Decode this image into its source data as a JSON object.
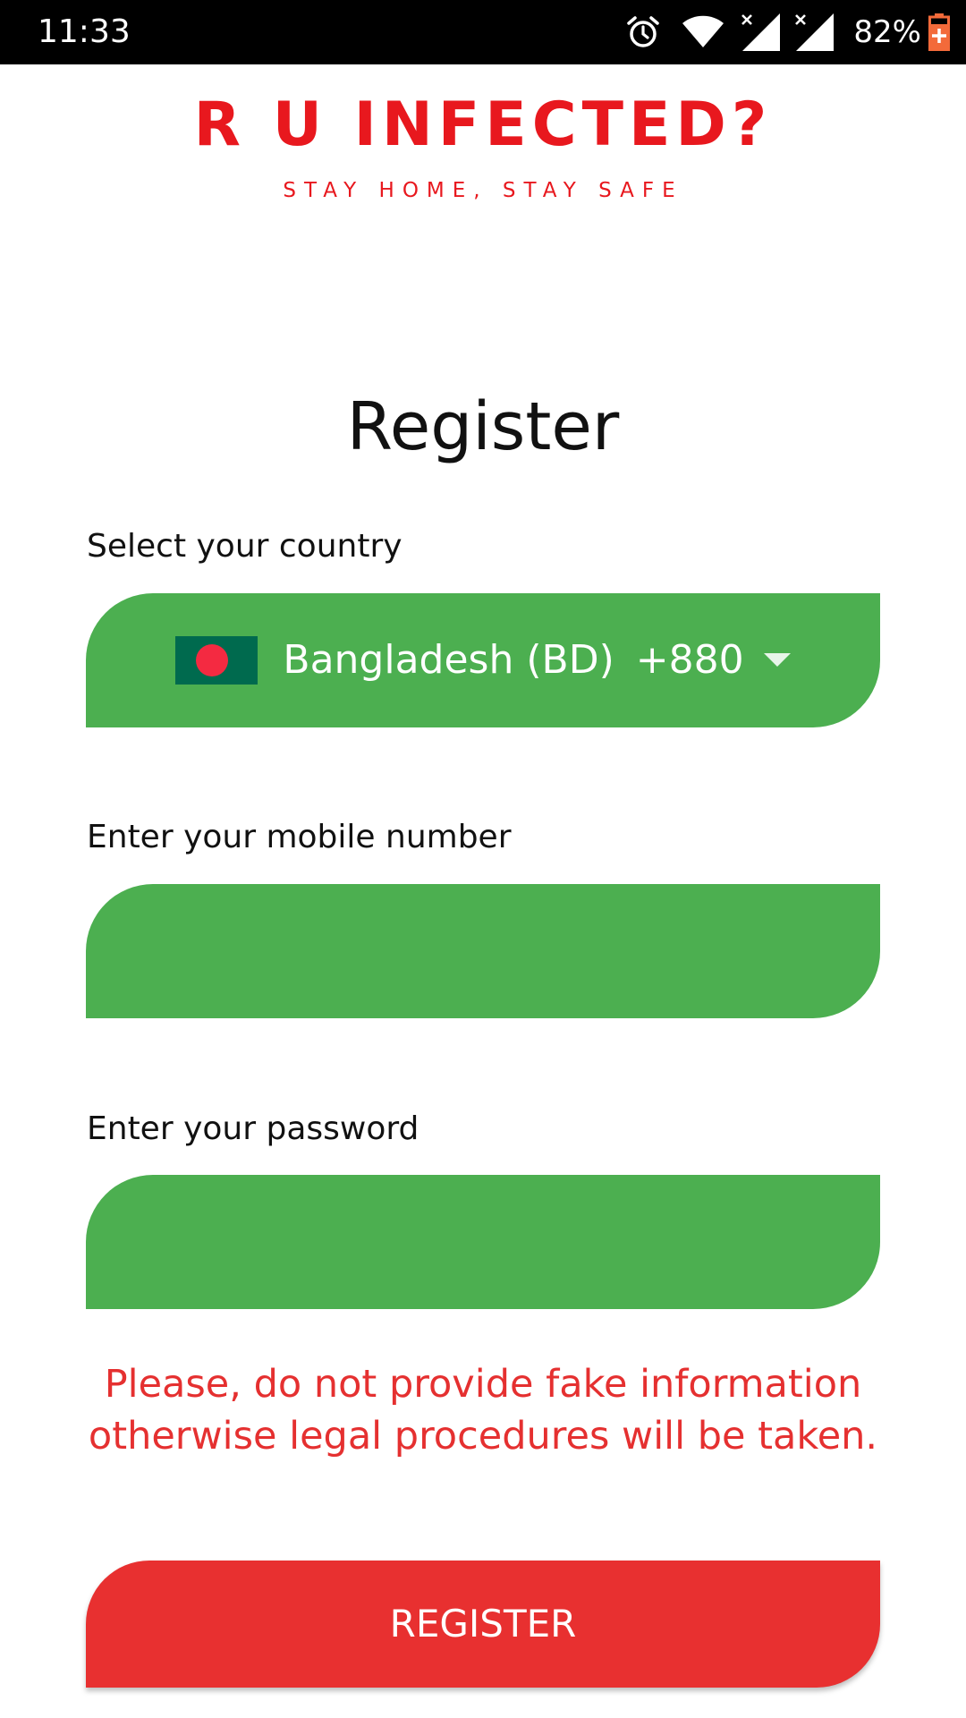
{
  "status_bar": {
    "time": "11:33",
    "battery_percent": "82%",
    "icons": [
      "alarm-icon",
      "wifi-icon",
      "signal-icon",
      "signal-icon",
      "battery-charging-icon"
    ]
  },
  "logo": {
    "title": "R U INFECTED?",
    "tagline": "STAY HOME, STAY SAFE"
  },
  "form": {
    "title": "Register",
    "country_label": "Select your country",
    "country": {
      "name": "Bangladesh (BD)",
      "dial_code": "+880",
      "flag": "bangladesh-flag-icon"
    },
    "mobile_label": "Enter your mobile number",
    "mobile_value": "",
    "password_label": "Enter your password",
    "password_value": "",
    "warning": "Please, do not provide fake information otherwise legal procedures will be taken.",
    "submit_label": "REGISTER"
  },
  "colors": {
    "brand_red": "#e8181e",
    "field_green": "#4caf50",
    "button_red": "#e83030",
    "warning_red": "#e53030"
  }
}
